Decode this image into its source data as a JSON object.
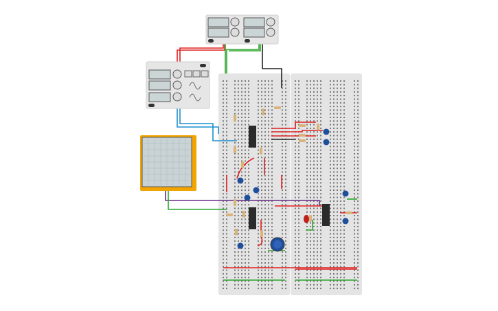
{
  "canvas": {
    "background": "#ffffff"
  },
  "colors": {
    "breadboard": "#e4e4e4",
    "instrument": "#e6e6e6",
    "display": "#ccd5d6",
    "oscilloscope_frame": "#f2a500",
    "wire_red": "#e02020",
    "wire_green": "#2aa52a",
    "wire_blue": "#1e8fd0",
    "wire_black": "#222222",
    "wire_purple": "#6a2a8a",
    "capacitor": "#1f4e9a",
    "ic": "#2b2b2b"
  },
  "components": {
    "power_supply": {
      "icon": "dc-power-supply-icon"
    },
    "function_generator": {
      "icon": "function-generator-icon",
      "waveforms": [
        "square",
        "triangle",
        "sine"
      ]
    },
    "oscilloscope": {
      "icon": "oscilloscope-icon"
    },
    "breadboards": 2,
    "op_amps": 3,
    "potentiometer": {
      "icon": "potentiometer-icon"
    },
    "led": {
      "icon": "led-icon",
      "color": "#c0201c"
    }
  }
}
